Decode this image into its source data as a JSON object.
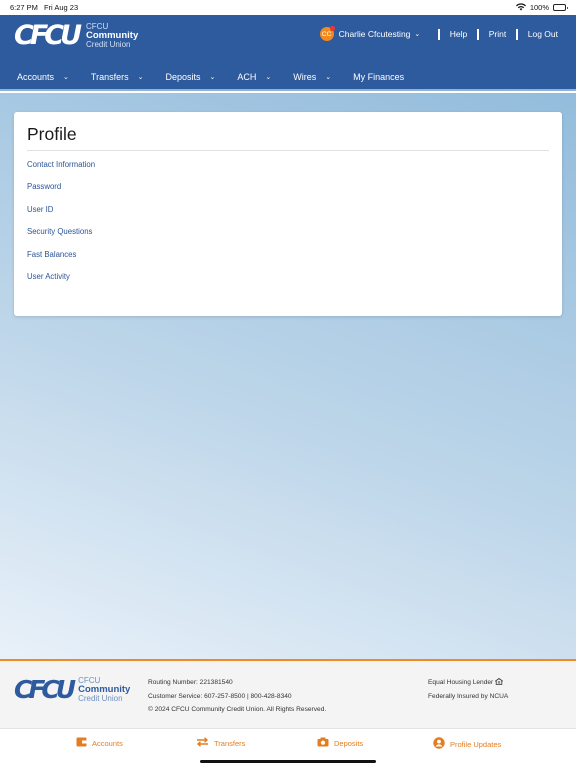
{
  "status_bar": {
    "time": "6:27 PM",
    "date": "Fri Aug 23",
    "battery": "100%"
  },
  "header": {
    "logo": {
      "mark": "CFCU",
      "line1": "CFCU",
      "line2": "Community",
      "line3": "Credit Union"
    },
    "user": {
      "initials": "CC",
      "name": "Charlie Cfcutesting"
    },
    "links": {
      "help": "Help",
      "print": "Print",
      "logout": "Log Out"
    }
  },
  "nav": [
    "Accounts",
    "Transfers",
    "Deposits",
    "ACH",
    "Wires",
    "My Finances"
  ],
  "profile": {
    "title": "Profile",
    "links": [
      "Contact Information",
      "Password",
      "User ID",
      "Security Questions",
      "Fast Balances",
      "User Activity"
    ]
  },
  "footer": {
    "routing": "Routing Number: 221381540",
    "service": "Customer Service: 607-257-8500 | 800-428-8340",
    "copyright": "© 2024 CFCU Community Credit Union. All Rights Reserved.",
    "equal_housing": "Equal Housing Lender",
    "ncua": "Federally Insured by NCUA"
  },
  "tabs": {
    "accounts": "Accounts",
    "transfers": "Transfers",
    "deposits": "Deposits",
    "profile_updates": "Profile Updates"
  },
  "colors": {
    "brand": "#2e5a9e",
    "accent": "#f08b24",
    "link": "#2b5597"
  },
  "icons": {
    "accounts_tab": "wallet-icon",
    "transfers_tab": "swap-arrows-icon",
    "deposits_tab": "camera-icon",
    "profile_tab": "user-circle-icon"
  }
}
